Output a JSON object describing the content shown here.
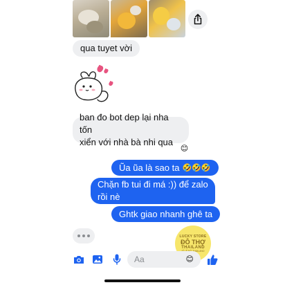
{
  "messages": {
    "m1": "qua tuyet vời",
    "m2": "ban đo bot dep lại nha tốn\nxiển với nhà bà nhi qua",
    "m3": "Ũa ũa là sao ta",
    "m3_emoji": "🤣🤣🤣",
    "m4": "Chặn fb tui đi má :)) để zalo\nrồi nè",
    "m5": "Ghtk giao nhanh ghê ta",
    "reaction": "😊"
  },
  "watermark": {
    "line1": "LUCKY STORE",
    "line2": "ĐÔ THỢ",
    "line3": "THAILAND",
    "line4": "SỈ LẺ ĐỒ THAILAND"
  },
  "composer": {
    "placeholder": "Aa",
    "emoji": "😊"
  },
  "colors": {
    "outgoing_bubble": "#1e63f0",
    "incoming_bubble": "#eeeff1",
    "accent": "#1e63f0",
    "heart": "#e75480"
  },
  "icons": [
    "share-icon",
    "camera-icon",
    "gallery-icon",
    "mic-icon",
    "like-icon",
    "typing-dots-icon"
  ]
}
